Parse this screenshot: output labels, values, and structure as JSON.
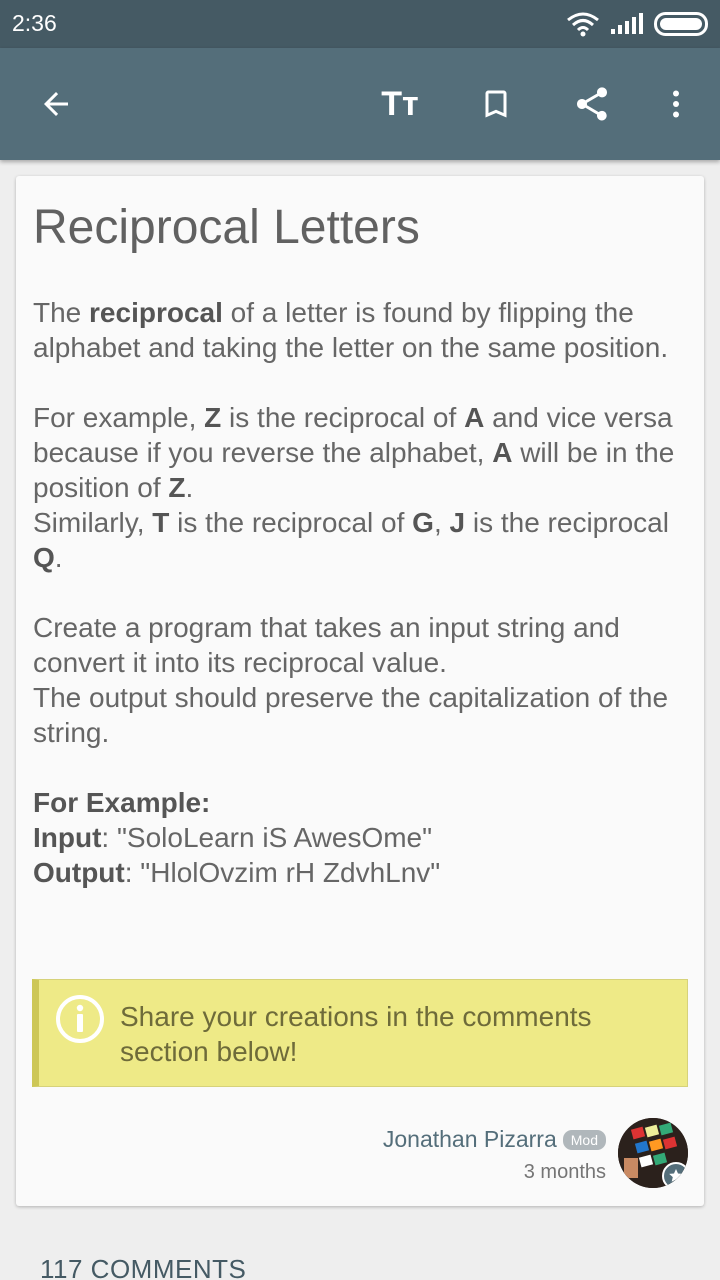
{
  "status_bar": {
    "time": "2:36"
  },
  "toolbar": {
    "back_icon": "arrow-left-icon",
    "text_size_label": "Tт",
    "bookmark_icon": "bookmark-icon",
    "share_icon": "share-icon",
    "more_icon": "more-vert-icon"
  },
  "article": {
    "title": "Reciprocal Letters",
    "p1_pre": "The ",
    "p1_bold": "reciprocal",
    "p1_post": " of a letter is found by flipping the alphabet and taking the letter on the same position.",
    "p2_a": "For example, ",
    "p2_b": "Z",
    "p2_c": " is the reciprocal of ",
    "p2_d": "A",
    "p2_e": " and vice versa because if you reverse the alphabet, ",
    "p2_f": "A",
    "p2_g": " will be in the position of ",
    "p2_h": "Z",
    "p2_i": ".",
    "p3_a": "Similarly, ",
    "p3_b": "T",
    "p3_c": " is the reciprocal of ",
    "p3_d": "G",
    "p3_e": ", ",
    "p3_f": "J",
    "p3_g": " is the reciprocal ",
    "p3_h": "Q",
    "p3_i": ".",
    "p4": "Create a program that takes an input string and convert it into its reciprocal value.",
    "p5": "The output should preserve the capitalization of the string.",
    "example_heading": "For Example:",
    "input_label": "Input",
    "input_value": ": \"SoloLearn iS AwesOme\"",
    "output_label": "Output",
    "output_value": ": \"HlolOvzim rH ZdvhLnv\""
  },
  "note": {
    "text": "Share your creations in the comments section below!"
  },
  "author": {
    "name": "Jonathan Pizarra",
    "badge": "Mod",
    "time_ago": "3 months"
  },
  "comments_header": "117 COMMENTS",
  "colors": {
    "appbar": "#546e7a",
    "statusbar": "#455a64",
    "note_bg": "#eeea87",
    "note_border": "#cdc756"
  }
}
